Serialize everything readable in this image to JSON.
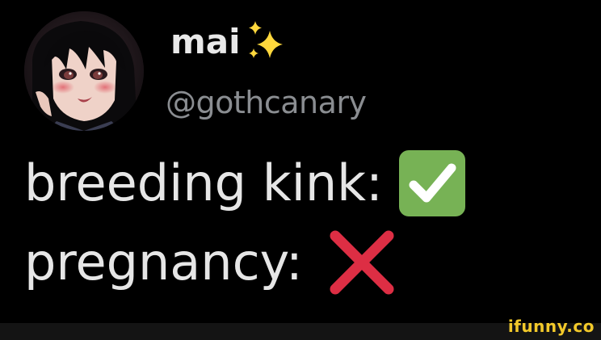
{
  "profile": {
    "display_name": "mai",
    "handle": "@gothcanary",
    "avatar_icon": "anime-girl-avatar",
    "name_emoji": "sparkles-icon"
  },
  "body": {
    "line1": "breeding kink:",
    "line1_emoji": "check-mark-button-icon",
    "line2": "pregnancy:",
    "line2_emoji": "cross-mark-icon"
  },
  "watermark": {
    "text": "ifunny.co"
  },
  "colors": {
    "background": "#000000",
    "name": "#e9e9e9",
    "handle": "#8a8d91",
    "body": "#e6e6e6",
    "check_green": "#77b255",
    "cross_red": "#dd2e44",
    "sparkle_yellow": "#ffd83d",
    "watermark_yellow": "#f2c92a"
  }
}
